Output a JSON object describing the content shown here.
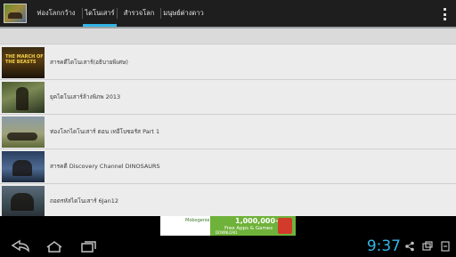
{
  "tabs": [
    {
      "label": "ท่องโลกกว้าง",
      "selected": false
    },
    {
      "label": "ไดโนเสาร์",
      "selected": true
    },
    {
      "label": "สำรวจโลก",
      "selected": false
    },
    {
      "label": "มนุษย์ต่างดาว",
      "selected": false
    }
  ],
  "list": [
    {
      "label": "สารคดีไดโนเสาร์(อธิบายพิเศษ)",
      "thumb_text": "THE MARCH OF THE BEASTS"
    },
    {
      "label": "ยุคไดโนเสาร์ล้างพิภพ 2013"
    },
    {
      "label": "ท่องโลกไดโนเสาร์ ตอน เทอีโบซอรัส Part 1"
    },
    {
      "label": "สารคดี Discovery Channel DINOSAURS"
    },
    {
      "label": "ถอดรหัสไดโนเสาร์ 6Jan12"
    }
  ],
  "ad": {
    "brand": "Mobogenie",
    "count": "1,000,000+",
    "tagline": "Free Apps & Games",
    "button": "DOWNLOAD"
  },
  "status": {
    "clock": "9:37"
  },
  "colors": {
    "accent": "#33b5e5",
    "actionbar": "#1e1e1e",
    "list_bg": "#ececec"
  }
}
